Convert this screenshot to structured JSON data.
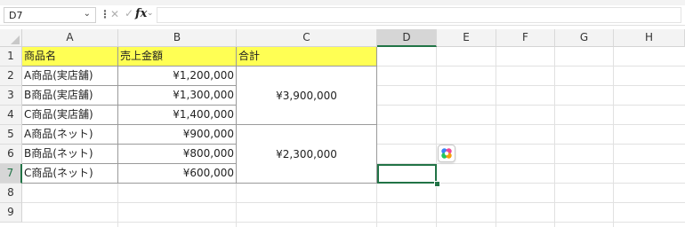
{
  "formula_bar": {
    "name_box": "D7",
    "name_box_chevron": "⌄",
    "dots": "⋮",
    "cancel_icon": "✕",
    "enter_icon": "✓",
    "fx_label": "fx",
    "fx_chevron": "⌄",
    "formula": ""
  },
  "columns": [
    "A",
    "B",
    "C",
    "D",
    "E",
    "F",
    "G",
    "H"
  ],
  "selected_column": "D",
  "rows": [
    "1",
    "2",
    "3",
    "4",
    "5",
    "6",
    "7",
    "8",
    "9"
  ],
  "selected_row": "7",
  "cells": {
    "A1": "商品名",
    "B1": "売上金額",
    "C1": "合計",
    "A2": "A商品(実店舗)",
    "B2": "¥1,200,000",
    "A3": "B商品(実店舗)",
    "B3": "¥1,300,000",
    "A4": "C商品(実店舗)",
    "B4": "¥1,400,000",
    "A5": "A商品(ネット)",
    "B5": "¥900,000",
    "A6": "B商品(ネット)",
    "B6": "¥800,000",
    "A7": "C商品(ネット)",
    "B7": "¥600,000",
    "C2_4": "¥3,900,000",
    "C5_7": "¥2,300,000"
  },
  "colors": {
    "header_fill": "#ffff54",
    "selection_accent": "#217346"
  }
}
